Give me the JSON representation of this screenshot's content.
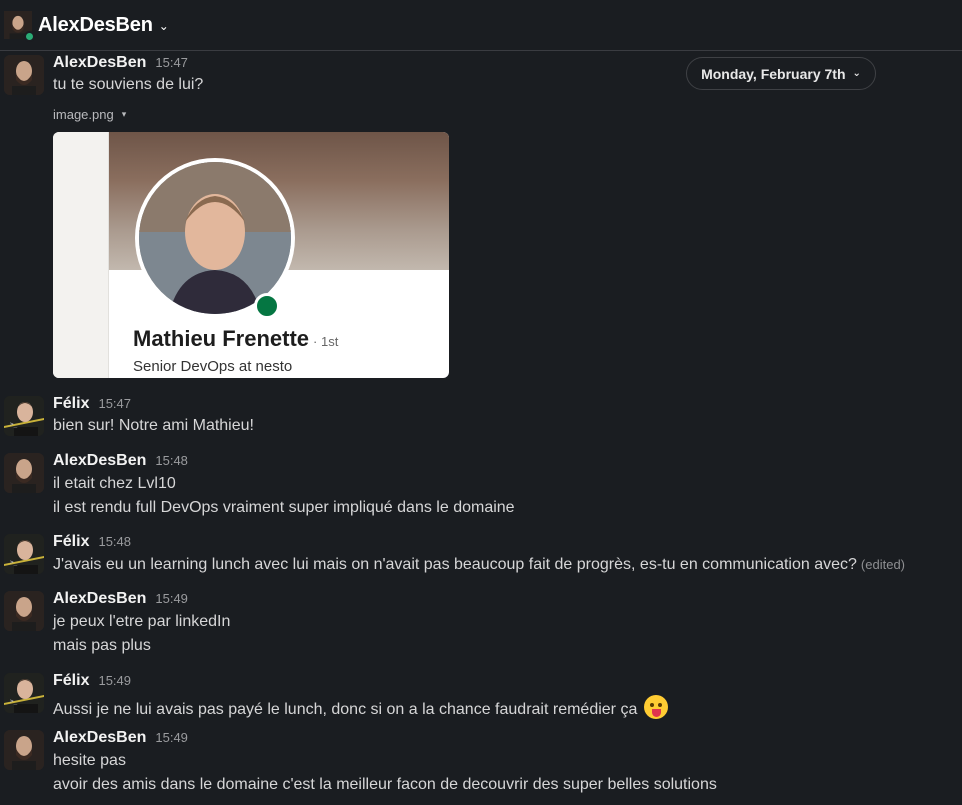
{
  "header": {
    "title": "AlexDesBen",
    "chevron": "⌄"
  },
  "date_divider": {
    "label": "Monday, February 7th",
    "chevron": "⌄"
  },
  "messages": [
    {
      "author": "AlexDesBen",
      "time": "15:47",
      "lines": [
        "tu te souviens de lui?"
      ],
      "attachment": {
        "filename": "image.png",
        "caret": "▾",
        "profile_name": "Mathieu Frenette",
        "profile_degree": "· 1st",
        "profile_title": "Senior DevOps at nesto"
      }
    },
    {
      "author": "Félix",
      "time": "15:47",
      "lines": [
        "bien sur! Notre ami Mathieu!"
      ]
    },
    {
      "author": "AlexDesBen",
      "time": "15:48",
      "lines": [
        "il etait chez Lvl10",
        "il est rendu full DevOps vraiment super impliqué dans le domaine"
      ]
    },
    {
      "author": "Félix",
      "time": "15:48",
      "lines": [
        "J'avais eu un learning lunch avec lui mais on n'avait pas beaucoup fait de progrès, es-tu en communication avec?"
      ],
      "edited": "(edited)"
    },
    {
      "author": "AlexDesBen",
      "time": "15:49",
      "lines": [
        "je peux l'etre par linkedIn",
        "mais pas plus"
      ]
    },
    {
      "author": "Félix",
      "time": "15:49",
      "lines": [
        "Aussi je ne lui avais pas payé le lunch, donc si on a la chance faudrait remédier ça"
      ],
      "emoji": "stuck-out-tongue"
    },
    {
      "author": "AlexDesBen",
      "time": "15:49",
      "lines": [
        "hesite pas",
        "avoir des amis dans le domaine c'est la meilleur facon de decouvrir des super belles solutions"
      ]
    }
  ],
  "colors": {
    "background": "#1a1d21",
    "presence": "#2bac76",
    "linkedin_online": "#057642"
  }
}
